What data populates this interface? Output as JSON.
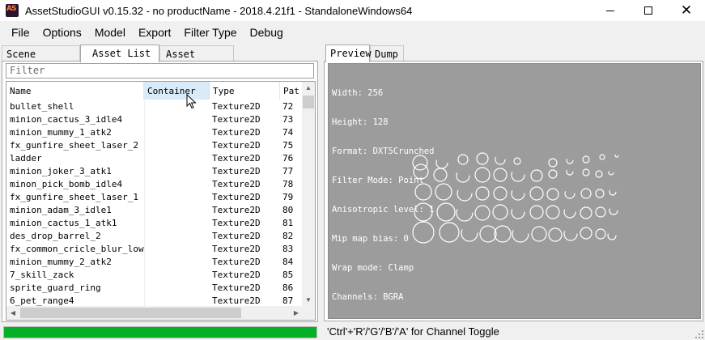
{
  "window": {
    "title": "AssetStudioGUI v0.15.32 - no productName - 2018.4.21f1 - StandaloneWindows64",
    "icon_text": "AS"
  },
  "menu": [
    "File",
    "Options",
    "Model",
    "Export",
    "Filter Type",
    "Debug"
  ],
  "left_tabs": [
    "Scene Hierarchy",
    "Asset List",
    "Asset Classes"
  ],
  "left_active_tab": "Asset List",
  "filter_placeholder": "Filter",
  "list": {
    "columns": [
      "Name",
      "Container",
      "Type",
      "Pat"
    ],
    "rows": [
      {
        "name": "bullet_shell",
        "container": "",
        "type": "Texture2D",
        "path": "72"
      },
      {
        "name": "minion_cactus_3_idle4",
        "container": "",
        "type": "Texture2D",
        "path": "73"
      },
      {
        "name": "minion_mummy_1_atk2",
        "container": "",
        "type": "Texture2D",
        "path": "74"
      },
      {
        "name": "fx_gunfire_sheet_laser_2",
        "container": "",
        "type": "Texture2D",
        "path": "75"
      },
      {
        "name": "ladder",
        "container": "",
        "type": "Texture2D",
        "path": "76"
      },
      {
        "name": "minion_joker_3_atk1",
        "container": "",
        "type": "Texture2D",
        "path": "77"
      },
      {
        "name": "minon_pick_bomb_idle4",
        "container": "",
        "type": "Texture2D",
        "path": "78"
      },
      {
        "name": "fx_gunfire_sheet_laser_1",
        "container": "",
        "type": "Texture2D",
        "path": "79"
      },
      {
        "name": "minion_adam_3_idle1",
        "container": "",
        "type": "Texture2D",
        "path": "80"
      },
      {
        "name": "minion_cactus_1_atk1",
        "container": "",
        "type": "Texture2D",
        "path": "81"
      },
      {
        "name": "des_drop_barrel_2",
        "container": "",
        "type": "Texture2D",
        "path": "82"
      },
      {
        "name": "fx_common_cricle_blur_low",
        "container": "",
        "type": "Texture2D",
        "path": "83"
      },
      {
        "name": "minion_mummy_2_atk2",
        "container": "",
        "type": "Texture2D",
        "path": "84"
      },
      {
        "name": "7_skill_zack",
        "container": "",
        "type": "Texture2D",
        "path": "85"
      },
      {
        "name": "sprite_guard_ring",
        "container": "",
        "type": "Texture2D",
        "path": "86"
      },
      {
        "name": "6_pet_range4",
        "container": "",
        "type": "Texture2D",
        "path": "87"
      }
    ]
  },
  "right_tabs": [
    "Preview",
    "Dump"
  ],
  "right_active_tab": "Preview",
  "preview_info": [
    "Width: 256",
    "Height: 128",
    "Format: DXT5Crunched",
    "Filter Mode: Point",
    "Anisotropic level: 1",
    "Mip map bias: 0",
    "Wrap mode: Clamp",
    "Channels: BGRA"
  ],
  "progress": {
    "fraction": 1.0
  },
  "status_text": "'Ctrl'+'R'/'G'/'B'/'A' for Channel Toggle",
  "colors": {
    "progress": "#06b025",
    "preview_bg": "#9c9c9c",
    "header_hover": "#d9ebf9"
  }
}
